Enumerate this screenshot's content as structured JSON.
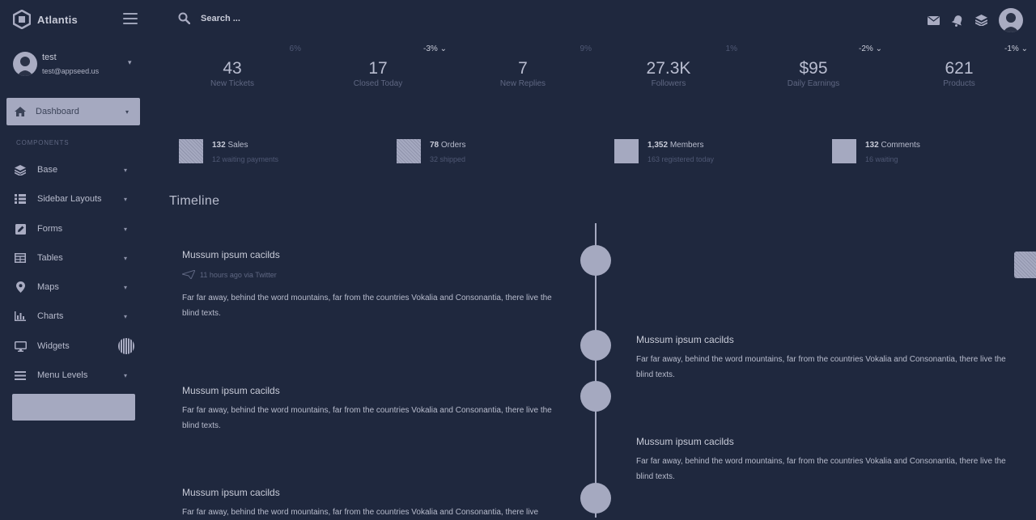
{
  "brand": {
    "name": "Atlantis"
  },
  "user": {
    "name": "test",
    "email": "test@appseed.us"
  },
  "search": {
    "placeholder": "Search ..."
  },
  "sidebar": {
    "active": {
      "label": "Dashboard"
    },
    "section_label": "COMPONENTS",
    "items": [
      {
        "label": "Base",
        "icon": "layers-icon"
      },
      {
        "label": "Sidebar Layouts",
        "icon": "list-icon"
      },
      {
        "label": "Forms",
        "icon": "pen-square-icon"
      },
      {
        "label": "Tables",
        "icon": "table-icon"
      },
      {
        "label": "Maps",
        "icon": "map-marker-icon"
      },
      {
        "label": "Charts",
        "icon": "bar-chart-icon"
      },
      {
        "label": "Widgets",
        "icon": "desktop-icon"
      },
      {
        "label": "Menu Levels",
        "icon": "bars-icon"
      }
    ]
  },
  "stats": [
    {
      "pct": "6%",
      "value": "43",
      "label": "New Tickets"
    },
    {
      "pct": "-3%",
      "value": "17",
      "label": "Closed Today"
    },
    {
      "pct": "9%",
      "value": "7",
      "label": "New Replies"
    },
    {
      "pct": "1%",
      "value": "27.3K",
      "label": "Followers"
    },
    {
      "pct": "-2%",
      "value": "$95",
      "label": "Daily Earnings"
    },
    {
      "pct": "-1%",
      "value": "621",
      "label": "Products"
    }
  ],
  "cards": [
    {
      "count": "132",
      "label": "Sales",
      "sub": "12 waiting payments"
    },
    {
      "count": "78",
      "label": "Orders",
      "sub": "32 shipped"
    },
    {
      "count": "1,352",
      "label": "Members",
      "sub": "163 registered today"
    },
    {
      "count": "132",
      "label": "Comments",
      "sub": "16 waiting"
    }
  ],
  "timeline": {
    "title": "Timeline",
    "entries": [
      {
        "heading": "Mussum ipsum cacilds",
        "meta": "11 hours ago via Twitter",
        "body": "Far far away, behind the word mountains, far from the countries Vokalia and Consonantia, there live the blind texts."
      },
      {
        "heading": "Mussum ipsum cacilds",
        "body": "Far far away, behind the word mountains, far from the countries Vokalia and Consonantia, there live the blind texts."
      },
      {
        "heading": "Mussum ipsum cacilds",
        "body": "Far far away, behind the word mountains, far from the countries Vokalia and Consonantia, there live the blind texts."
      },
      {
        "heading": "Mussum ipsum cacilds",
        "body": "Far far away, behind the word mountains, far from the countries Vokalia and Consonantia, there live the blind texts."
      },
      {
        "heading": "Mussum ipsum cacilds",
        "body": "Far far away, behind the word mountains, far from the countries Vokalia and Consonantia, there live"
      }
    ]
  },
  "colors": {
    "background": "#1f283e",
    "accent": "#a5a9c0",
    "text": "#b8bccd",
    "muted": "#5f6782"
  }
}
